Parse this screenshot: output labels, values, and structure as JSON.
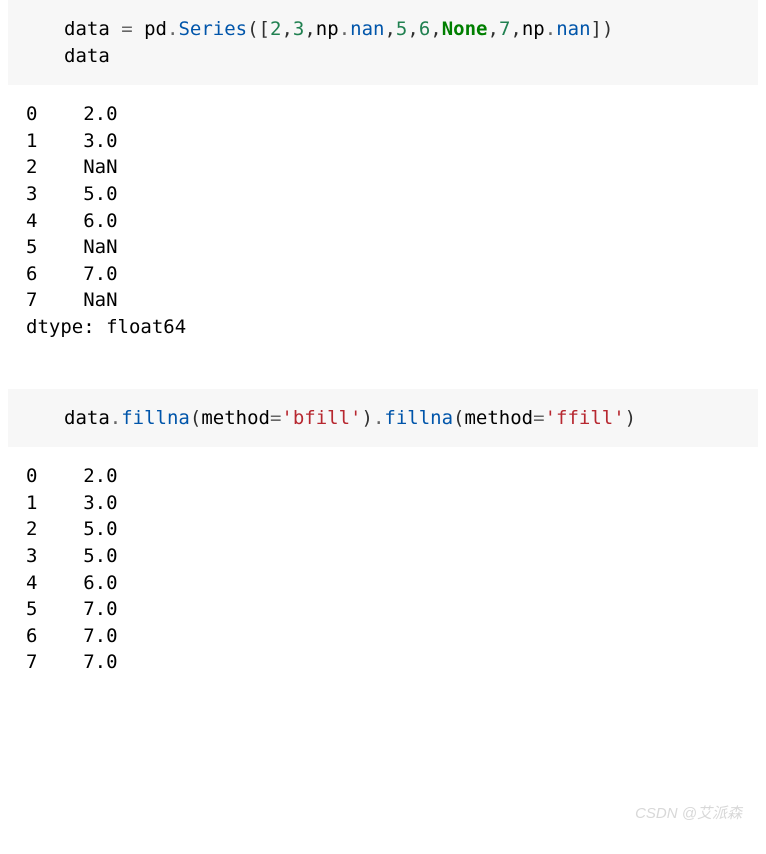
{
  "cell1": {
    "code": {
      "v_data": "data",
      "eq": " = ",
      "v_pd": "pd",
      "dot1": ".",
      "fn_series": "Series",
      "lpar": "(",
      "lbracket": "[",
      "n2": "2",
      "c1": ",",
      "n3": "3",
      "c2": ",",
      "v_np1": "np",
      "dot2": ".",
      "attr_nan1": "nan",
      "c3": ",",
      "n5": "5",
      "c4": ",",
      "n6": "6",
      "c5": ",",
      "kw_none": "None",
      "c6": ",",
      "n7": "7",
      "c7": ",",
      "v_np2": "np",
      "dot3": ".",
      "attr_nan2": "nan",
      "rbracket": "]",
      "rpar": ")",
      "line2": "data"
    },
    "output_lines": [
      "0    2.0",
      "1    3.0",
      "2    NaN",
      "3    5.0",
      "4    6.0",
      "5    NaN",
      "6    7.0",
      "7    NaN",
      "dtype: float64"
    ]
  },
  "cell2": {
    "code": {
      "v_data": "data",
      "dot1": ".",
      "fn_fillna1": "fillna",
      "lpar1": "(",
      "kw_method1": "method",
      "eq1": "=",
      "str_bfill": "'bfill'",
      "rpar1": ")",
      "dot2": ".",
      "fn_fillna2": "fillna",
      "lpar2": "(",
      "kw_method2": "method",
      "eq2": "=",
      "str_ffill": "'ffill'",
      "rpar2": ")"
    },
    "output_lines": [
      "0    2.0",
      "1    3.0",
      "2    5.0",
      "3    5.0",
      "4    6.0",
      "5    7.0",
      "6    7.0",
      "7    7.0"
    ]
  },
  "watermark": "CSDN @艾派森"
}
